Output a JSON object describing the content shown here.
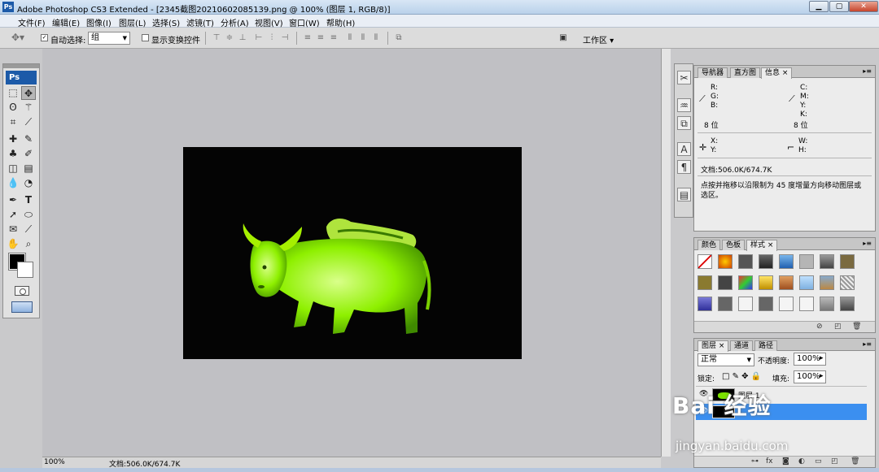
{
  "window": {
    "title": "Adobe Photoshop CS3 Extended - [2345截图20210602085139.png @ 100% (图层 1, RGB/8)]",
    "app_icon": "Ps"
  },
  "menu": [
    "文件(F)",
    "编辑(E)",
    "图像(I)",
    "图层(L)",
    "选择(S)",
    "滤镜(T)",
    "分析(A)",
    "视图(V)",
    "窗口(W)",
    "帮助(H)"
  ],
  "options": {
    "auto_select_label": "自动选择:",
    "auto_select_value": "组",
    "show_transform_label": "显示变换控件",
    "workspace_label": "工作区"
  },
  "toolbox": {
    "logo": "Ps"
  },
  "status": {
    "zoom": "100%",
    "doc": "文档:506.0K/674.7K"
  },
  "info_panel": {
    "tabs": [
      "导航器",
      "直方图",
      "信息"
    ],
    "r": "R:",
    "g": "G:",
    "b": "B:",
    "c": "C:",
    "m": "M:",
    "y": "Y:",
    "k": "K:",
    "bits_left": "8 位",
    "bits_right": "8 位",
    "x": "X:",
    "y2": "Y:",
    "w": "W:",
    "h": "H:",
    "doc": "文档:506.0K/674.7K",
    "hint": "点按并拖移以沿限制为 45 度增量方向移动图层或选区。"
  },
  "styles_panel": {
    "tabs": [
      "颜色",
      "色板",
      "样式"
    ]
  },
  "layers_panel": {
    "tabs": [
      "图层",
      "通道",
      "路径"
    ],
    "blend_mode": "正常",
    "opacity_label": "不透明度:",
    "opacity_value": "100%",
    "lock_label": "锁定:",
    "fill_label": "填充:",
    "fill_value": "100%",
    "layer1_name": "图层 1"
  },
  "watermark": {
    "main": "Bai 经验",
    "sub": "jingyan.baidu.com"
  },
  "colors": {
    "canvas_bg": "#040404",
    "ox_green": "#7be000",
    "selection_blue": "#3b8ff0",
    "ps_blue": "#1c5aa8"
  }
}
